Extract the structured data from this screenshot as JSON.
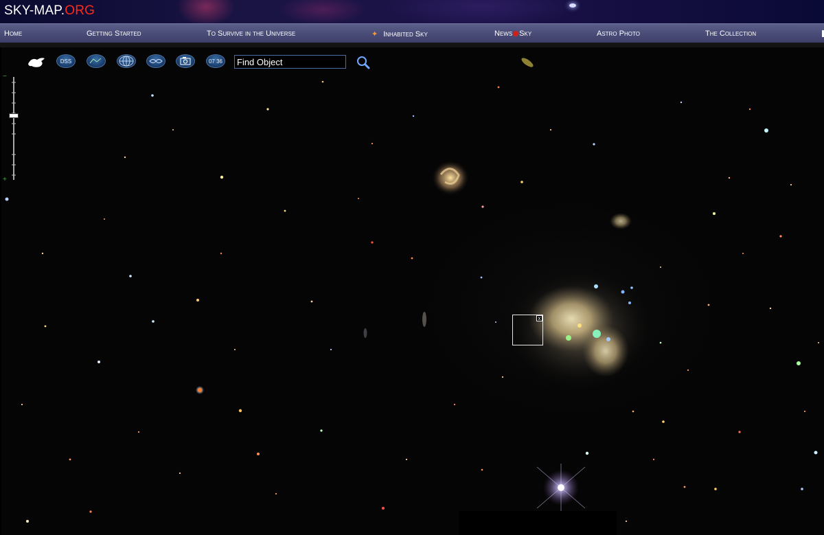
{
  "header": {
    "logo_main": "SKY-MAP.",
    "logo_accent": "ORG",
    "colors": {
      "logo_accent": "#ff2a1a",
      "nav_bg": "#4a4c78",
      "sky_bg": "#050505"
    }
  },
  "nav": {
    "home": "Home",
    "getting_started": "Getting Started",
    "survive": "To Survive in the Universe",
    "inhabited": "Inhabited Sky",
    "news_prefix": "News",
    "news_suffix": "Sky",
    "astro_photo": "Astro Photo",
    "collection": "The Collection"
  },
  "toolbar": {
    "tools": [
      {
        "icon": "dragon-logo-icon",
        "label": ""
      },
      {
        "icon": "dss-layer-icon",
        "label": "DSS"
      },
      {
        "icon": "constellation-icon",
        "label": ""
      },
      {
        "icon": "grid-globe-icon",
        "label": ""
      },
      {
        "icon": "milky-way-icon",
        "label": ""
      },
      {
        "icon": "camera-icon",
        "label": ""
      },
      {
        "icon": "time-icon",
        "label": "07 36"
      }
    ],
    "search": {
      "value": "Find Object",
      "icon": "magnifier-icon"
    }
  },
  "zoom": {
    "plus_icon": "zoom-in-icon",
    "minus_icon": "zoom-out-icon",
    "level": 0.35
  },
  "selection": {
    "close_label": "x"
  }
}
